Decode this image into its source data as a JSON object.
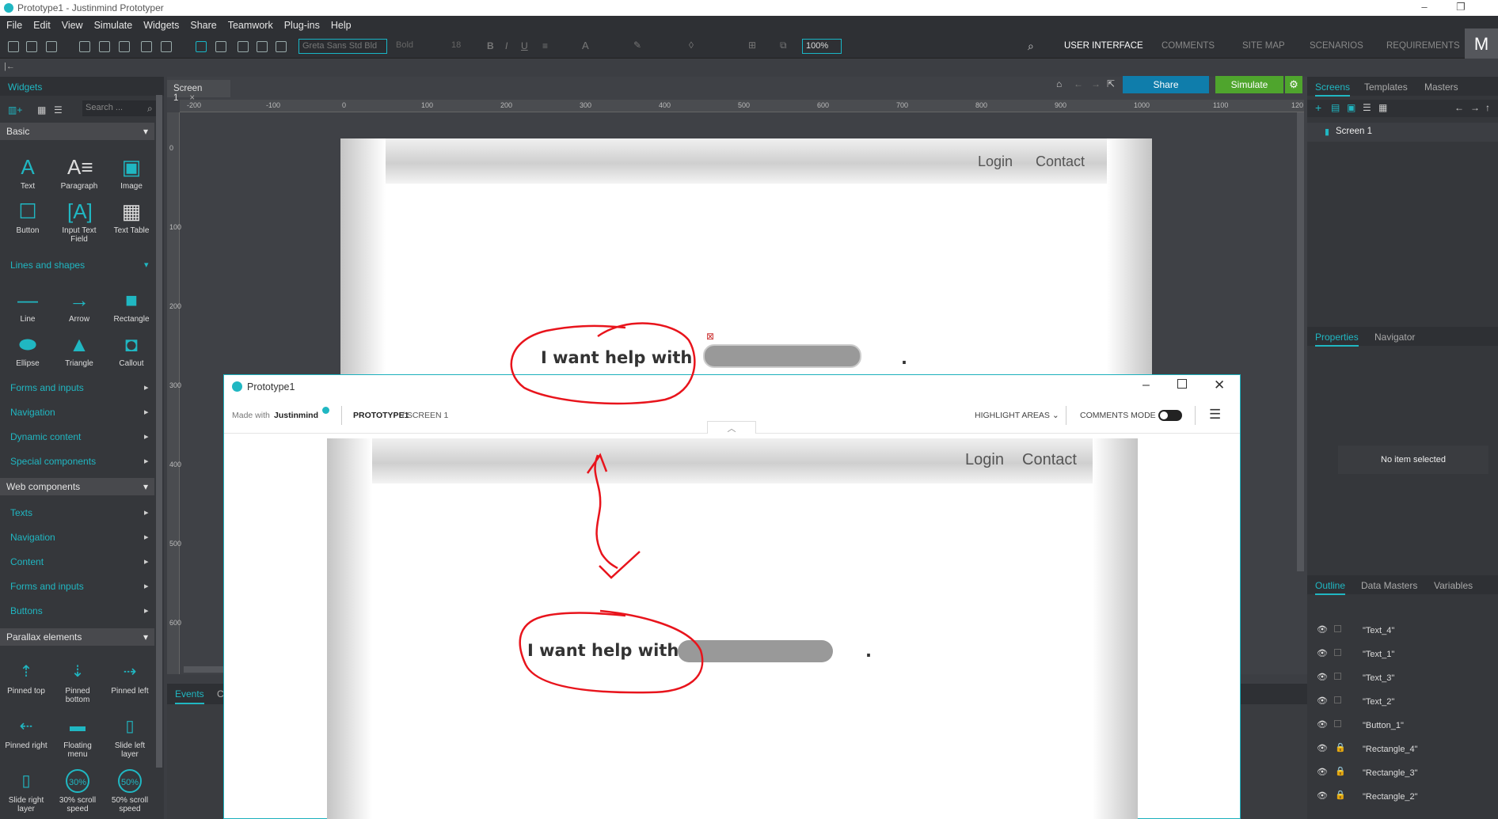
{
  "app": {
    "window_title": "Prototype1 - Justinmind Prototyper",
    "menu": [
      "File",
      "Edit",
      "View",
      "Simulate",
      "Widgets",
      "Share",
      "Teamwork",
      "Plug-ins",
      "Help"
    ],
    "font_family": "Greta Sans Std Bld",
    "font_weight": "Bold",
    "font_size": "18",
    "zoom": "100%",
    "top_tabs": [
      "USER INTERFACE",
      "COMMENTS",
      "SITE MAP",
      "SCENARIOS",
      "REQUIREMENTS"
    ],
    "user_initial": "M"
  },
  "left_panel": {
    "tab": "Widgets",
    "search_placeholder": "Search ...",
    "basic_label": "Basic",
    "basic_widgets": [
      "Text",
      "Paragraph",
      "Image",
      "Button",
      "Input Text Field",
      "Text Table"
    ],
    "lines_label": "Lines and shapes",
    "shape_widgets": [
      "Line",
      "Arrow",
      "Rectangle",
      "Ellipse",
      "Triangle",
      "Callout"
    ],
    "basic_links": [
      "Forms and inputs",
      "Navigation",
      "Dynamic content",
      "Special components"
    ],
    "web_components_label": "Web components",
    "web_links": [
      "Texts",
      "Navigation",
      "Content",
      "Forms and inputs",
      "Buttons"
    ],
    "parallax_label": "Parallax elements",
    "parallax_widgets": [
      "Pinned top",
      "Pinned bottom",
      "Pinned left",
      "Pinned right",
      "Floating menu",
      "Slide left layer",
      "Slide right layer",
      "30% scroll speed",
      "50% scroll speed"
    ],
    "scroll_badges": [
      "30%",
      "50%"
    ]
  },
  "canvas": {
    "screen_tab": "Screen 1",
    "share_label": "Share",
    "simulate_label": "Simulate",
    "ruler_h": [
      "-200",
      "-100",
      "0",
      "100",
      "200",
      "300",
      "400",
      "500",
      "600",
      "700",
      "800",
      "900",
      "1000",
      "1100",
      "120"
    ],
    "ruler_v": [
      "0",
      "100",
      "200",
      "300",
      "400",
      "500",
      "600"
    ],
    "nav_links": [
      "Login",
      "Contact"
    ],
    "help_text": "I want help with",
    "period": ".",
    "bottom_tabs": [
      "Events",
      "C"
    ]
  },
  "right_panel": {
    "top_tabs": [
      "Screens",
      "Templates",
      "Masters"
    ],
    "screen_item": "Screen 1",
    "mid_tabs": [
      "Properties",
      "Navigator"
    ],
    "no_selection": "No item selected",
    "bottom_tabs": [
      "Outline",
      "Data Masters",
      "Variables"
    ],
    "outline_items": [
      "\"Text_4\"",
      "\"Text_1\"",
      "\"Text_3\"",
      "\"Text_2\"",
      "\"Button_1\"",
      "\"Rectangle_4\"",
      "\"Rectangle_3\"",
      "\"Rectangle_2\""
    ]
  },
  "popup": {
    "title": "Prototype1",
    "made_with": "Made with",
    "brand": "Justinmind",
    "breadcrumb_project": "PROTOTYPE1",
    "breadcrumb_screen": " / SCREEN 1",
    "highlight_label": "HIGHLIGHT AREAS",
    "comments_label": "COMMENTS MODE",
    "nav_links": [
      "Login",
      "Contact"
    ],
    "help_text": "I want help with",
    "period": "."
  },
  "colors": {
    "accent": "#20b7c2",
    "share": "#0f7dab",
    "simulate": "#4fa52d",
    "annotation": "#e8141c"
  }
}
